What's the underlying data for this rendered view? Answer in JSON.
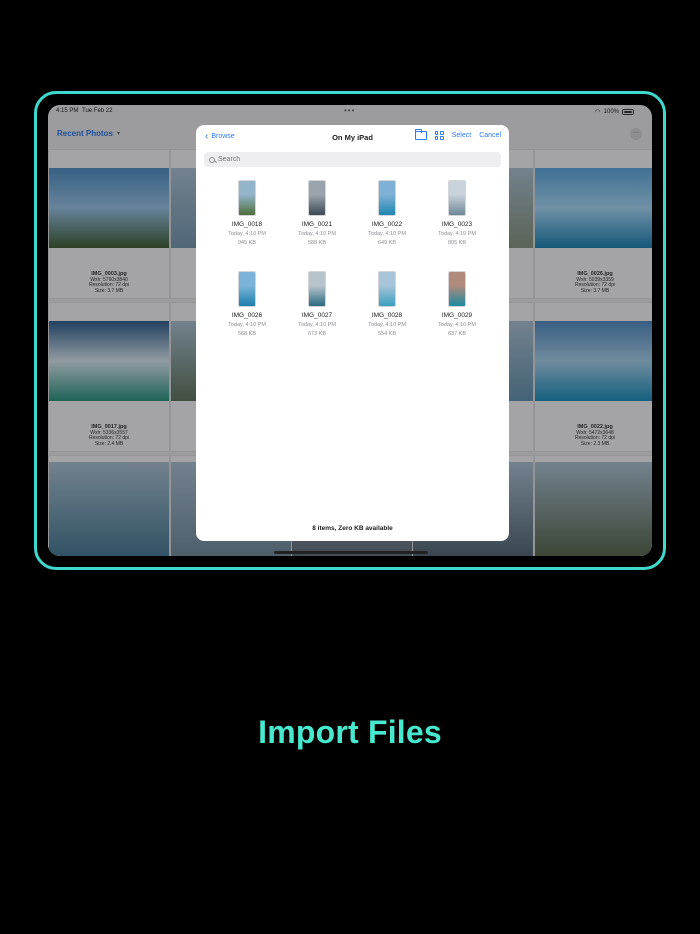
{
  "status": {
    "time": "4:15 PM",
    "date": "Tue Feb 22",
    "battery": "100%"
  },
  "app": {
    "title": "Recent Photos"
  },
  "background_cells": [
    {
      "name": "IMG_0003.jpg",
      "dims": "Wxh: 5760x3840",
      "res": "Resolution: 72 dpi",
      "size": "Size: 3.7 MB",
      "colors": [
        "#4e86b8",
        "#8fb6d8",
        "#3d5a33"
      ]
    },
    {
      "name": "IMG_0026.jpg",
      "dims": "Wxh: 5039x3359",
      "res": "Resolution: 72 dpi",
      "size": "Size: 3.7 MB",
      "colors": [
        "#5a9ccd",
        "#9bc9e6",
        "#1f7aa8"
      ]
    },
    {
      "name": "IMG_0017.jpg",
      "dims": "Wxh: 5336x3557",
      "res": "Resolution: 72 dpi",
      "size": "Size: 2.4 MB",
      "colors": [
        "#2f5a84",
        "#c9d7e0",
        "#2c8a7a"
      ]
    },
    {
      "name": "IMG_0022.jpg",
      "dims": "Wxh: 5472x3648",
      "res": "Resolution: 72 dpi",
      "size": "Size: 2.3 MB",
      "colors": [
        "#4f83b5",
        "#9cc3dc",
        "#1e85b0"
      ]
    }
  ],
  "modal": {
    "back_label": "Browse",
    "title": "On My iPad",
    "select_label": "Select",
    "cancel_label": "Cancel",
    "search_placeholder": "Search",
    "footer": "8 items, Zero KB available",
    "files": [
      {
        "name": "IMG_0018",
        "date": "Today, 4:10 PM",
        "size": "945 KB",
        "colors": [
          "#93b4c9",
          "#4e6e3e"
        ]
      },
      {
        "name": "IMG_0021",
        "date": "Today, 4:10 PM",
        "size": "588 KB",
        "colors": [
          "#9aa4ad",
          "#3a4a55"
        ]
      },
      {
        "name": "IMG_0022",
        "date": "Today, 4:10 PM",
        "size": "649 KB",
        "colors": [
          "#7fb1d6",
          "#1f86b0"
        ]
      },
      {
        "name": "IMG_0023",
        "date": "Today, 4:10 PM",
        "size": "805 KB",
        "colors": [
          "#c8d3db",
          "#6f8796"
        ]
      },
      {
        "name": "IMG_0026",
        "date": "Today, 4:10 PM",
        "size": "568 KB",
        "colors": [
          "#7db3d8",
          "#1b7fae"
        ]
      },
      {
        "name": "IMG_0027",
        "date": "Today, 4:10 PM",
        "size": "673 KB",
        "colors": [
          "#b8c4cc",
          "#2a6c80"
        ]
      },
      {
        "name": "IMG_0028",
        "date": "Today, 4:10 PM",
        "size": "554 KB",
        "colors": [
          "#a7c4d8",
          "#3aa0c0"
        ]
      },
      {
        "name": "IMG_0029",
        "date": "Today, 4:10 PM",
        "size": "637 KB",
        "colors": [
          "#b08a7a",
          "#1d8aa0"
        ]
      }
    ]
  },
  "caption": "Import Files",
  "colors": {
    "accent": "#46e8ce",
    "frame": "#3fd8cc",
    "link": "#2e7cf6"
  }
}
